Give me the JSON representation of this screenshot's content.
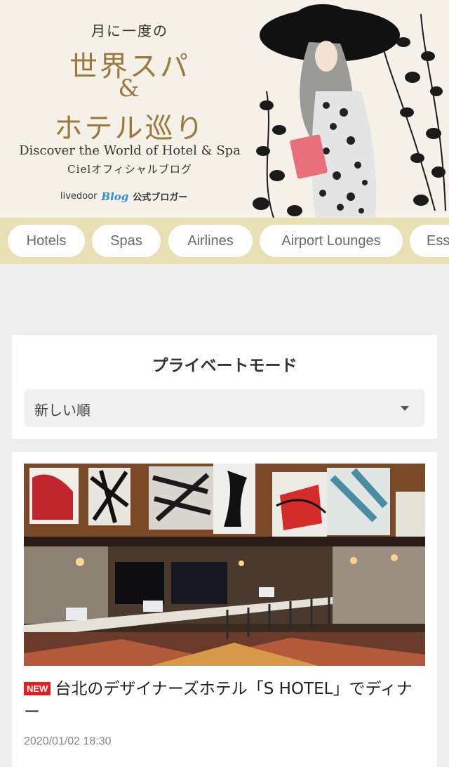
{
  "header": {
    "tagline_small": "月に一度の",
    "title_line1": "世界スパ",
    "title_line2": "&",
    "title_line3": "ホテル巡り",
    "subtitle_en": "Discover the World of Hotel & Spa",
    "subtitle_ja": "Cielオフィシャルブログ",
    "platform": "livedoor",
    "platform_blog": "Blog",
    "official_label": "公式ブロガー"
  },
  "categories": [
    {
      "label": "Hotels"
    },
    {
      "label": "Spas"
    },
    {
      "label": "Airlines"
    },
    {
      "label": "Airport Lounges"
    },
    {
      "label": "Ess"
    }
  ],
  "mode": {
    "title": "プライベートモード",
    "sort_selected": "新しい順"
  },
  "article": {
    "badge": "NEW",
    "title": "台北のデザイナーズホテル「S HOTEL」でディナー",
    "date": "2020/01/02 18:30"
  },
  "colors": {
    "banner_bg": "#f6f1e8",
    "title_gold": "#9a7a3c",
    "catbar_bg": "#e8dfb4",
    "badge_red": "#e02020",
    "page_bg": "#eeeeee"
  }
}
